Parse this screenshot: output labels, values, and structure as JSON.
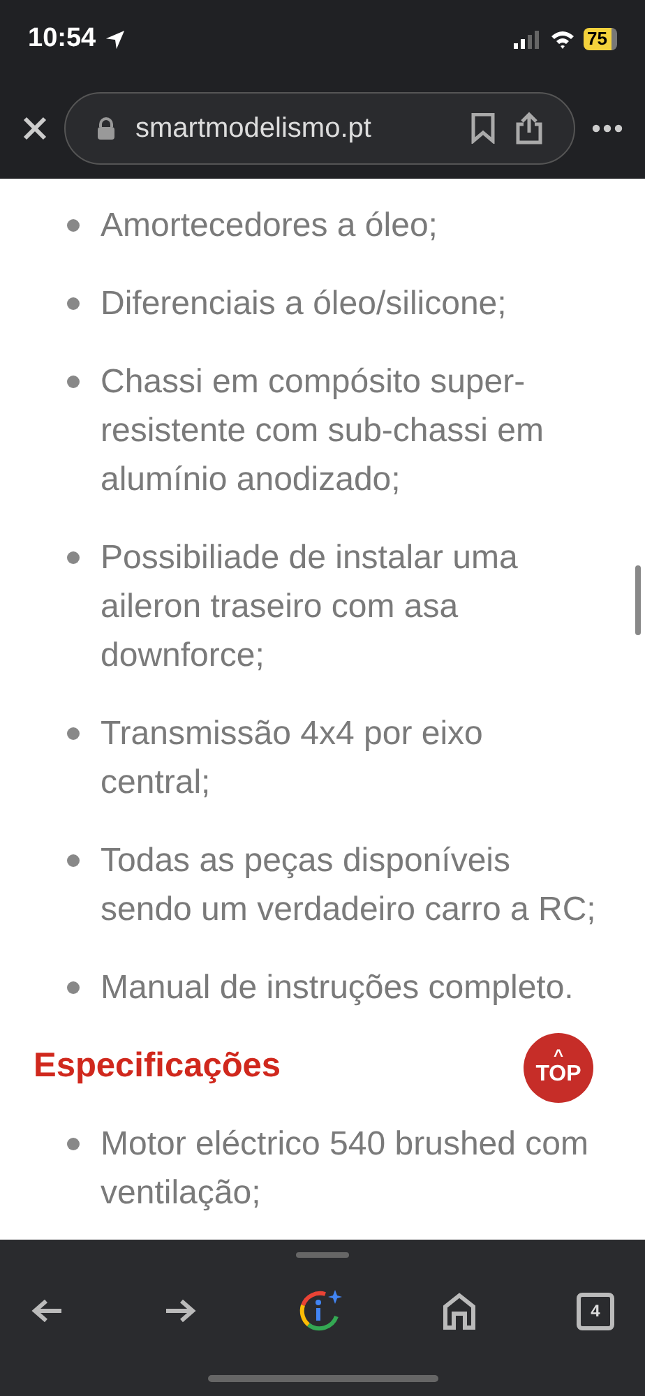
{
  "status_bar": {
    "time": "10:54",
    "battery": "75"
  },
  "address_bar": {
    "url": "smartmodelismo.pt"
  },
  "content": {
    "features": [
      "Amortecedores a óleo;",
      "Diferenciais a óleo/silicone;",
      "Chassi em compósito super-resistente com sub-chassi em alumínio anodizado;",
      "Possibiliade de instalar uma aileron traseiro com asa downforce;",
      "Transmissão 4x4 por eixo central;",
      "Todas as peças disponíveis sendo um verdadeiro carro a RC;",
      "Manual de instruções completo."
    ],
    "heading": "Especificações",
    "specs": [
      "Motor eléctrico 540 brushed com ventilação;"
    ],
    "top_button": {
      "arrow": "^",
      "label": "TOP"
    }
  },
  "toolbar": {
    "tab_count": "4"
  }
}
